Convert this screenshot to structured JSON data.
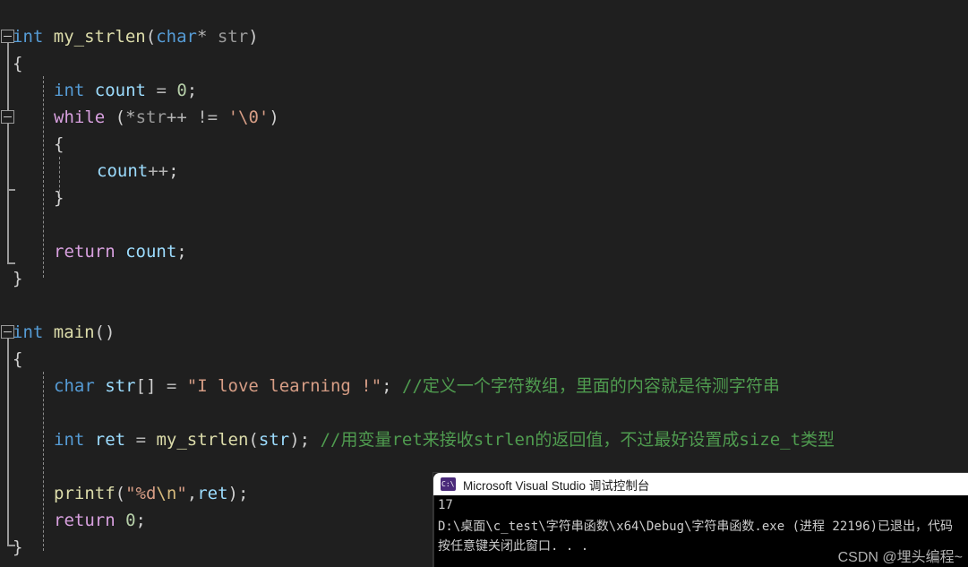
{
  "editor": {
    "background": "#1f1f1f",
    "language": "C",
    "code_lines": [
      {
        "indent": 0,
        "fold": true,
        "text": "int my_strlen(char* str)"
      },
      {
        "indent": 0,
        "fold": false,
        "text": "{"
      },
      {
        "indent": 1,
        "fold": false,
        "text": "int count = 0;"
      },
      {
        "indent": 1,
        "fold": true,
        "text": "while (*str++ != '\\0')"
      },
      {
        "indent": 1,
        "fold": false,
        "text": "{"
      },
      {
        "indent": 2,
        "fold": false,
        "text": "count++;"
      },
      {
        "indent": 1,
        "fold": false,
        "text": "}"
      },
      {
        "indent": 1,
        "fold": false,
        "text": ""
      },
      {
        "indent": 1,
        "fold": false,
        "text": "return count;"
      },
      {
        "indent": 0,
        "fold": false,
        "text": "}"
      },
      {
        "indent": 0,
        "fold": false,
        "text": ""
      },
      {
        "indent": 0,
        "fold": true,
        "text": "int main()"
      },
      {
        "indent": 0,
        "fold": false,
        "text": "{"
      },
      {
        "indent": 1,
        "fold": false,
        "text": "char str[] = \"I love learning !\"; //定义一个字符数组，里面的内容就是待测字符串"
      },
      {
        "indent": 1,
        "fold": false,
        "text": ""
      },
      {
        "indent": 1,
        "fold": false,
        "text": "int ret = my_strlen(str); //用变量ret来接收strlen的返回值，不过最好设置成size_t类型"
      },
      {
        "indent": 1,
        "fold": false,
        "text": ""
      },
      {
        "indent": 1,
        "fold": false,
        "text": "printf(\"%d\\n\",ret);"
      },
      {
        "indent": 1,
        "fold": false,
        "text": "return 0;"
      },
      {
        "indent": 0,
        "fold": false,
        "text": "}"
      }
    ],
    "tokens": {
      "l1": {
        "kw": "int",
        "fn": "my_strlen",
        "open": "(",
        "type": "char",
        "star": "*",
        "param": "str",
        "close": ")"
      },
      "l2": {
        "brace": "{"
      },
      "l3": {
        "kw": "int",
        "var": "count",
        "eq": "=",
        "num": "0",
        "semi": ";"
      },
      "l4": {
        "ctl": "while",
        "open": "(",
        "star": "*",
        "var": "str",
        "inc": "++",
        "neq": "!=",
        "chr": "'\\0'",
        "close": ")"
      },
      "l5": {
        "brace": "{"
      },
      "l6": {
        "var": "count",
        "inc": "++",
        "semi": ";"
      },
      "l7": {
        "brace": "}"
      },
      "l9": {
        "ctl": "return",
        "var": "count",
        "semi": ";"
      },
      "l10": {
        "brace": "}"
      },
      "l12": {
        "kw": "int",
        "fn": "main",
        "parens": "()"
      },
      "l13": {
        "brace": "{"
      },
      "l14": {
        "kw": "char",
        "var": "str",
        "brackets": "[]",
        "eq": "=",
        "str": "\"I love learning !\"",
        "semi": ";",
        "comment": "//定义一个字符数组，里面的内容就是待测字符串"
      },
      "l16": {
        "kw": "int",
        "var": "ret",
        "eq": "=",
        "fn": "my_strlen",
        "open": "(",
        "arg": "str",
        "close": ")",
        "semi": ";",
        "comment": "//用变量ret来接收strlen的返回值，不过最好设置成size_t类型"
      },
      "l18": {
        "fn": "printf",
        "open": "(",
        "str": "\"%d",
        "esc": "\\n",
        "str2": "\"",
        "comma": ",",
        "var": "ret",
        "close": ")",
        "semi": ";"
      },
      "l19": {
        "ctl": "return",
        "num": "0",
        "semi": ";"
      },
      "l20": {
        "brace": "}"
      }
    },
    "colors": {
      "keyword": "#569cd6",
      "control": "#d8a0df",
      "function": "#dcdcaa",
      "variable": "#9cdcfe",
      "number": "#b5cea8",
      "string": "#d69d85",
      "escape": "#d7ba7d",
      "comment": "#4f9b4f",
      "punctuation": "#cfcfcf",
      "parameter": "#9a9a9a"
    }
  },
  "console": {
    "title": "Microsoft Visual Studio 调试控制台",
    "icon_name": "cmd-console-icon",
    "output_lines": [
      "17",
      "D:\\桌面\\c_test\\字符串函数\\x64\\Debug\\字符串函数.exe (进程 22196)已退出，代码",
      "按任意键关闭此窗口. . ."
    ],
    "line1": "17",
    "line2": "D:\\桌面\\c_test\\字符串函数\\x64\\Debug\\字符串函数.exe (进程 22196)已退出，代码",
    "line3": "按任意键关闭此窗口. . ."
  },
  "watermark": {
    "text": "CSDN @埋头编程~"
  }
}
